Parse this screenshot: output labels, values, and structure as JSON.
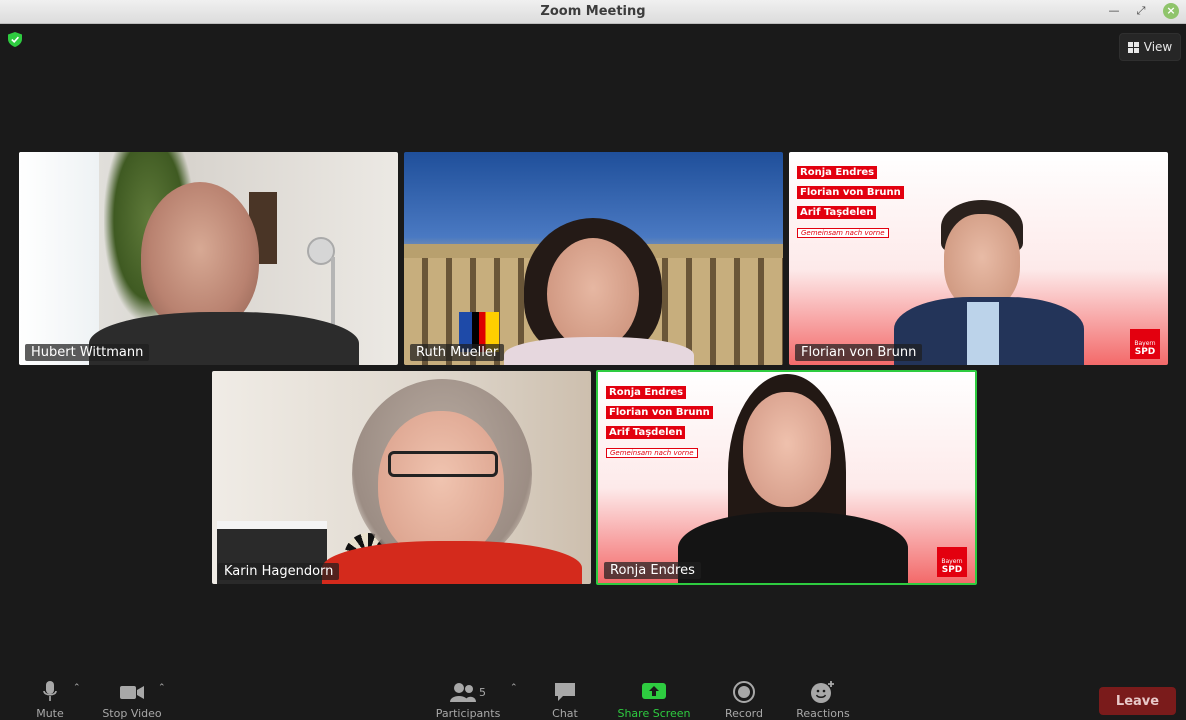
{
  "window": {
    "title": "Zoom Meeting"
  },
  "header": {
    "view_label": "View"
  },
  "participants": [
    {
      "name": "Hubert Wittmann"
    },
    {
      "name": "Ruth Mueller"
    },
    {
      "name": "Florian von Brunn"
    },
    {
      "name": "Karin Hagendorn"
    },
    {
      "name": "Ronja Endres"
    }
  ],
  "banner": {
    "lines": [
      "Ronja Endres",
      "Florian von Brunn",
      "Arif Taşdelen"
    ],
    "slogan": "Gemeinsam nach vorne",
    "logo_top": "Bayern",
    "logo_main": "SPD"
  },
  "toolbar": {
    "mute_label": "Mute",
    "stop_video_label": "Stop Video",
    "participants_label": "Participants",
    "participants_count": "5",
    "chat_label": "Chat",
    "share_screen_label": "Share Screen",
    "record_label": "Record",
    "reactions_label": "Reactions",
    "leave_label": "Leave"
  },
  "colors": {
    "active_speaker": "#2ecc40",
    "spd_red": "#e3000f",
    "share_green": "#2ecc40",
    "leave_bg": "#7a1b1b"
  }
}
